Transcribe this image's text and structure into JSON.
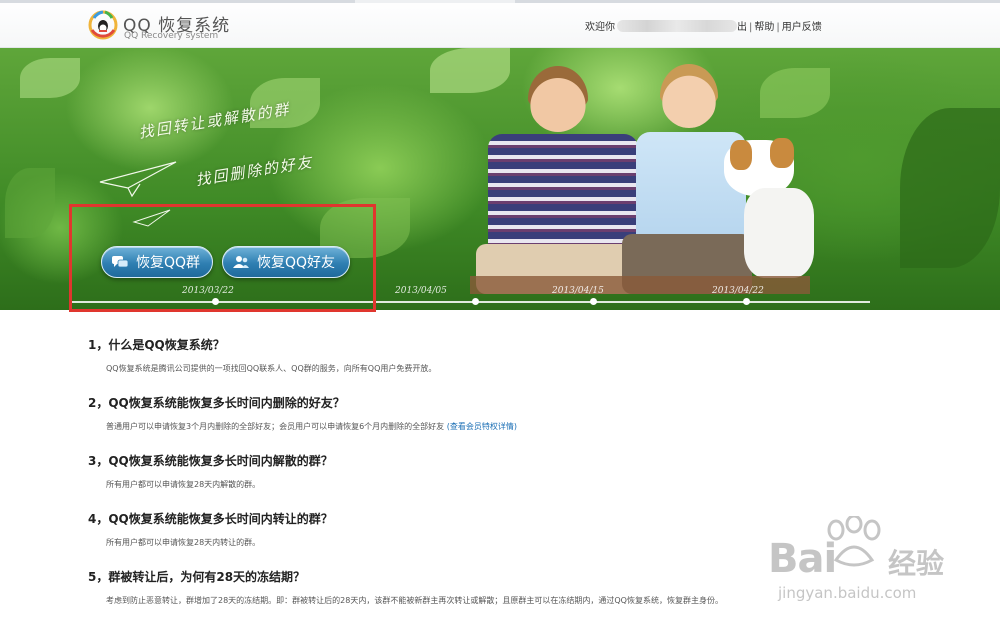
{
  "header": {
    "app_title": "QQ 恢复系统",
    "app_subtitle": "QQ Recovery system",
    "welcome": "欢迎你",
    "logout_suffix": "出",
    "help": "帮助",
    "feedback": "用户反馈"
  },
  "banner": {
    "slogan_1": "找回转让或解散的群",
    "slogan_2": "找回删除的好友",
    "buttons": {
      "recover_group": "恢复QQ群",
      "recover_friend": "恢复QQ好友"
    },
    "timeline_dates": [
      "2013/03/22",
      "2013/04/05",
      "2013/04/15",
      "2013/04/22"
    ]
  },
  "faq": [
    {
      "question": "1，什么是QQ恢复系统？",
      "answer": "QQ恢复系统是腾讯公司提供的一项找回QQ联系人、QQ群的服务，向所有QQ用户免费开放。"
    },
    {
      "question": "2，QQ恢复系统能恢复多长时间内删除的好友？",
      "answer": "普通用户可以申请恢复3个月内删除的全部好友；会员用户可以申请恢复6个月内删除的全部好友",
      "link": "(查看会员特权详情)"
    },
    {
      "question": "3，QQ恢复系统能恢复多长时间内解散的群？",
      "answer": "所有用户都可以申请恢复28天内解散的群。"
    },
    {
      "question": "4，QQ恢复系统能恢复多长时间内转让的群？",
      "answer": "所有用户都可以申请恢复28天内转让的群。"
    },
    {
      "question": "5，群被转让后，为何有28天的冻结期？",
      "answer": "考虑到防止恶意转让，群增加了28天的冻结期。即：群被转让后的28天内，该群不能被新群主再次转让或解散；且原群主可以在冻结期内，通过QQ恢复系统，恢复群主身份。"
    }
  ],
  "watermark": {
    "brand": "Bai",
    "brand_tail": "经验",
    "url": "jingyan.baidu.com"
  },
  "colors": {
    "highlight_box": "#e0362e",
    "button_blue": "#2f7fb2",
    "link_blue": "#1b6fb5"
  }
}
